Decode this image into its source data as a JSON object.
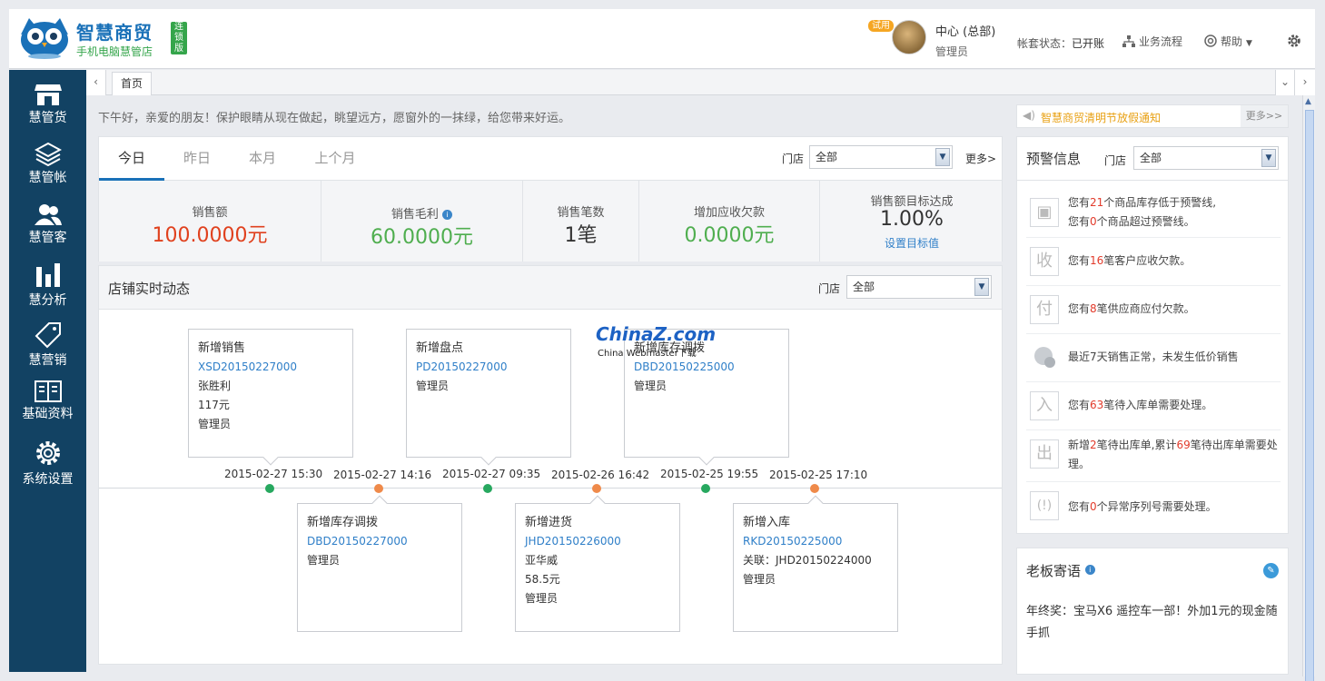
{
  "header": {
    "logo_title": "智慧商贸",
    "logo_subtitle": "手机电脑慧管店",
    "logo_tag": "连锁版",
    "trial_badge": "试用",
    "store_name": "中心 (总部)",
    "role": "管理员",
    "account_status_label": "帐套状态：",
    "account_status_value": "已开账",
    "business_flow": "业务流程",
    "help": "帮助"
  },
  "sidebar": {
    "items": [
      {
        "label": "慧管货",
        "icon": "store-icon"
      },
      {
        "label": "慧管帐",
        "icon": "coins-icon"
      },
      {
        "label": "慧管客",
        "icon": "users-icon"
      },
      {
        "label": "慧分析",
        "icon": "bar-chart-icon"
      },
      {
        "label": "慧营销",
        "icon": "tag-icon"
      },
      {
        "label": "基础资料",
        "icon": "book-icon"
      },
      {
        "label": "系统设置",
        "icon": "gear-icon"
      }
    ]
  },
  "tabs": {
    "home": "首页"
  },
  "greeting": "下午好，亲爱的朋友！保护眼睛从现在做起，眺望远方，愿窗外的一抹绿，给您带来好运。",
  "stats": {
    "period_tabs": [
      "今日",
      "昨日",
      "本月",
      "上个月"
    ],
    "active_period": "今日",
    "store_label": "门店",
    "store_value": "全部",
    "more": "更多>",
    "cells": [
      {
        "label": "销售额",
        "value": "100.0000元",
        "color": "#e0411e"
      },
      {
        "label": "销售毛利",
        "value": "60.0000元",
        "color": "#4fae4f"
      },
      {
        "label": "销售笔数",
        "value": "1笔",
        "color": "#333333"
      },
      {
        "label": "增加应收欠款",
        "value": "0.0000元",
        "color": "#4fae4f"
      },
      {
        "label": "销售额目标达成",
        "value": "1.00%",
        "color": "#333333",
        "link": "设置目标值"
      }
    ]
  },
  "dynamics": {
    "title": "店铺实时动态",
    "store_label": "门店",
    "store_value": "全部",
    "events": [
      {
        "time": "2015-02-27 15:30",
        "color": "#27a85f",
        "title": "新增销售",
        "id": "XSD20150227000",
        "lines": [
          "张胜利",
          "117元",
          "管理员"
        ]
      },
      {
        "time": "2015-02-27 14:16",
        "color": "#ef8a4a",
        "title": "新增库存调拨",
        "id": "DBD20150227000",
        "lines": [
          "管理员"
        ]
      },
      {
        "time": "2015-02-27 09:35",
        "color": "#27a85f",
        "title": "新增盘点",
        "id": "PD20150227000",
        "lines": [
          "管理员"
        ]
      },
      {
        "time": "2015-02-26 16:42",
        "color": "#ef8a4a",
        "title": "新增进货",
        "id": "JHD20150226000",
        "lines": [
          "亚华威",
          "58.5元",
          "管理员"
        ]
      },
      {
        "time": "2015-02-25 19:55",
        "color": "#27a85f",
        "title": "新增库存调拨",
        "id": "DBD20150225000",
        "lines": [
          "管理员"
        ]
      },
      {
        "time": "2015-02-25 17:10",
        "color": "#ef8a4a",
        "title": "新增入库",
        "id": "RKD20150225000",
        "lines": [
          "关联：JHD20150224000",
          "管理员"
        ]
      }
    ]
  },
  "notice": {
    "text": "智慧商贸清明节放假通知",
    "more": "更多>>"
  },
  "warnings": {
    "title": "预警信息",
    "store_label": "门店",
    "store_value": "全部",
    "rows": [
      {
        "icon": "box-icon",
        "pre": "您有",
        "n": "21",
        "post": "个商品库存低于预警线,",
        "line2_pre": "您有",
        "n2": "0",
        "line2_post": "个商品超过预警线。"
      },
      {
        "icon": "receive-icon",
        "glyph": "收",
        "pre": "您有",
        "n": "16",
        "post": "笔客户应收欠款。"
      },
      {
        "icon": "pay-icon",
        "glyph": "付",
        "pre": "您有",
        "n": "8",
        "post": "笔供应商应付欠款。"
      },
      {
        "icon": "price-icon",
        "glyph": "",
        "pre": "最近7天销售正常，未发生低价销售",
        "n": "",
        "post": ""
      },
      {
        "icon": "in-icon",
        "glyph": "入",
        "pre": "您有",
        "n": "63",
        "post": "笔待入库单需要处理。"
      },
      {
        "icon": "out-icon",
        "glyph": "出",
        "pre": "新增",
        "n": "2",
        "post": "笔待出库单,累计",
        "n2": "69",
        "line2_post": "笔待出库单需要处",
        "line3": "理。"
      },
      {
        "icon": "serial-icon",
        "glyph": "",
        "pre": "您有",
        "n": "0",
        "post": "个异常序列号需要处理。"
      }
    ]
  },
  "boss": {
    "title": "老板寄语",
    "text": "年终奖：宝马X6 遥控车一部！外加1元的现金随手抓"
  },
  "watermark": {
    "big": "ChinaZ.com",
    "small": "China Webmaster下载"
  }
}
